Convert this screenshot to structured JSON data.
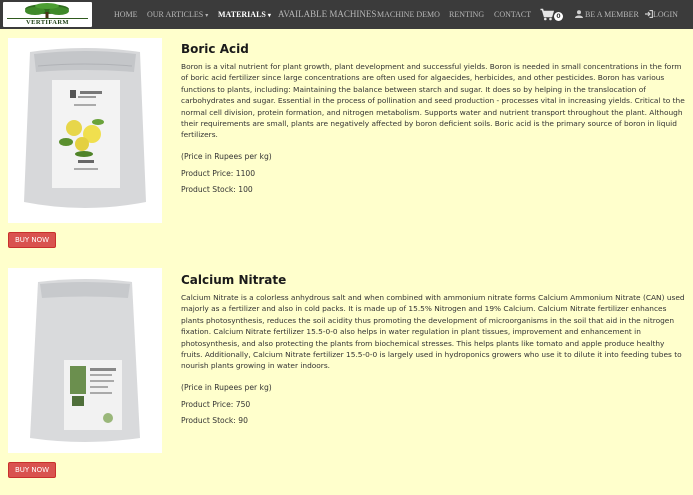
{
  "brand": {
    "logo_text": "VERTIFARM"
  },
  "nav": {
    "home": "HOME",
    "articles": "OUR ARTICLES",
    "materials": "MATERIALS",
    "machines": "AVAILABLE MACHINES",
    "demo": "MACHINE DEMO",
    "renting": "RENTING",
    "contact": "CONTACT",
    "cart_count": "0",
    "member": "BE A MEMBER",
    "login": "LOGIN"
  },
  "products": [
    {
      "title": "Boric Acid",
      "description": "Boron is a vital nutrient for plant growth, plant development and successful yields. Boron is needed in small concentrations in the form of boric acid fertilizer since large concentrations are often used for algaecides, herbicides, and other pesticides. Boron has various functions to plants, including: Maintaining the balance between starch and sugar. It does so by helping in the translocation of carbohydrates and sugar. Essential in the process of pollination and seed production - processes vital in increasing yields. Critical to the normal cell division, protein formation, and nitrogen metabolism. Supports water and nutrient transport throughout the plant. Although their requirements are small, plants are negatively affected by boron deficient soils. Boric acid is the primary source of boron in liquid fertilizers.",
      "price_note": "(Price in Rupees per kg)",
      "price": "Product Price: 1100",
      "stock": "Product Stock: 100",
      "buy_label": "BUY NOW"
    },
    {
      "title": "Calcium Nitrate",
      "description": "Calcium Nitrate is a colorless anhydrous salt and when combined with ammonium nitrate forms Calcium Ammonium Nitrate (CAN) used majorly as a fertilizer and also in cold packs. It is made up of 15.5% Nitrogen and 19% Calcium. Calcium Nitrate fertilizer enhances plants photosynthesis, reduces the soil acidity thus promoting the development of microorganisms in the soil that aid in the nitrogen fixation. Calcium Nitrate fertilizer 15.5-0-0 also helps in water regulation in plant tissues, improvement and enhancement in photosynthesis, and also protecting the plants from biochemical stresses. This helps plants like tomato and apple produce healthy fruits. Additionally, Calcium Nitrate fertilizer 15.5-0-0 is largely used in hydroponics growers who use it to dilute it into feeding tubes to nourish plants growing in water indoors.",
      "price_note": "(Price in Rupees per kg)",
      "price": "Product Price: 750",
      "stock": "Product Stock: 90",
      "buy_label": "BUY NOW"
    }
  ],
  "colors": {
    "navbar": "#3b3b3b",
    "background": "#ffffcc",
    "buy_button": "#d9534f"
  }
}
